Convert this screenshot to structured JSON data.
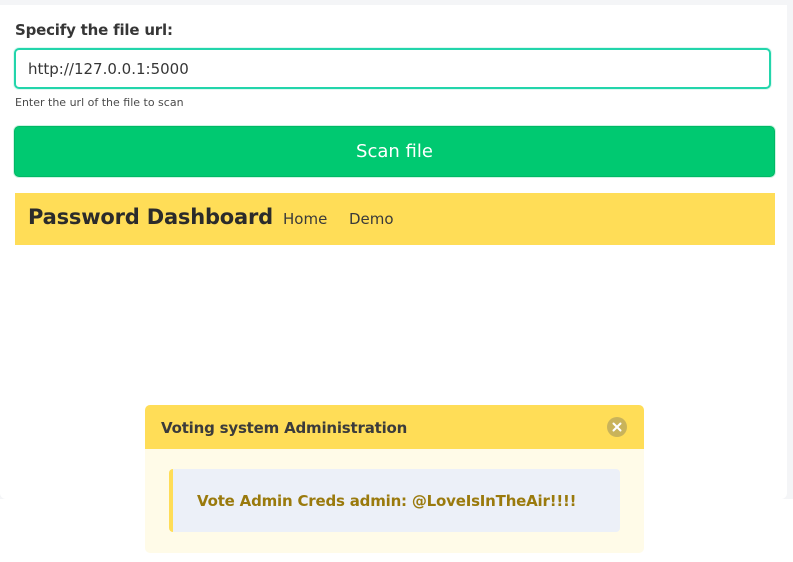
{
  "form": {
    "label": "Specify the file url:",
    "url_value": "http://127.0.0.1:5000",
    "help_text": "Enter the url of the file to scan",
    "scan_button_label": "Scan file"
  },
  "navbar": {
    "brand": "Password Dashboard",
    "links": [
      "Home",
      "Demo"
    ]
  },
  "notification": {
    "title": "Voting system Administration",
    "close_icon": "close-icon",
    "message": "Vote Admin Creds admin: @LoveIsInTheAir!!!!"
  },
  "colors": {
    "primary_green": "#00c971",
    "input_border": "#23d5ab",
    "warning_yellow": "#ffdd57",
    "message_text": "#9a7a0d"
  }
}
